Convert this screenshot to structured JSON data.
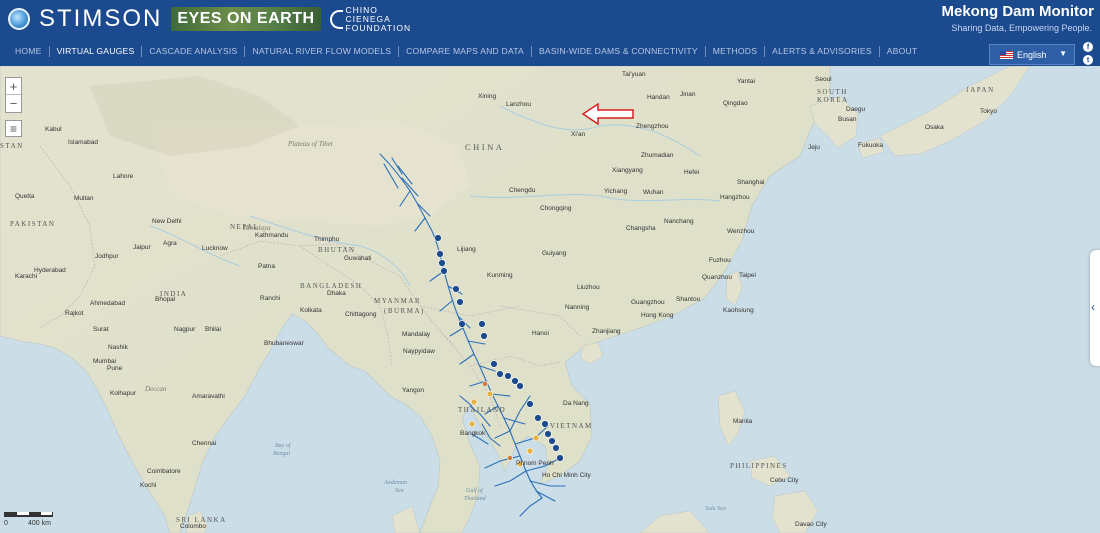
{
  "header": {
    "stimson": "STIMSON",
    "eyes_on_earth": "EYES ON EARTH",
    "chino_line1": "CHINO",
    "chino_line2": "CIENEGA",
    "chino_line3": "FOUNDATION",
    "title": "Mekong Dam Monitor",
    "subtitle": "Sharing Data, Empowering People."
  },
  "nav": {
    "items": [
      {
        "label": "HOME",
        "active": false
      },
      {
        "label": "VIRTUAL GAUGES",
        "active": true
      },
      {
        "label": "CASCADE ANALYSIS",
        "active": false
      },
      {
        "label": "NATURAL RIVER FLOW MODELS",
        "active": false
      },
      {
        "label": "COMPARE MAPS AND DATA",
        "active": false
      },
      {
        "label": "BASIN-WIDE DAMS & CONNECTIVITY",
        "active": false
      },
      {
        "label": "METHODS",
        "active": false
      },
      {
        "label": "ALERTS & ADVISORIES",
        "active": false
      },
      {
        "label": "ABOUT",
        "active": false
      }
    ]
  },
  "language": {
    "selected": "English",
    "caret": "▼"
  },
  "social": {
    "facebook": "f",
    "twitter": "t"
  },
  "map_controls": {
    "zoom_in": "+",
    "zoom_out": "−",
    "layers": "≡",
    "side_toggle": "‹"
  },
  "scale": {
    "start": "0",
    "end": "400 km"
  },
  "map_labels": {
    "countries": [
      "CHINA",
      "INDIA",
      "PAKISTAN",
      "BANGLADESH",
      "BHUTAN",
      "MYANMAR",
      "(BURMA)",
      "THAILAND",
      "VIETNAM",
      "PHILIPPINES",
      "SRI LANKA",
      "JAPAN",
      "SOUTH",
      "KOREA",
      "NEPAL",
      "STAN"
    ],
    "regions": [
      "Plateau of Tibet"
    ],
    "seas": [
      "Bay of",
      "Bengal",
      "Andaman",
      "Sea",
      "Gulf of",
      "Thailand",
      "Sulu Sea"
    ],
    "cities": [
      "Tai'yuan",
      "Xining",
      "Lanzhou",
      "Handan",
      "Jinan",
      "Yantai",
      "Qingdao",
      "Seoul",
      "Daegu",
      "Busan",
      "Osaka",
      "Tokyo",
      "Jeju",
      "Fukuoka",
      "Xi'an",
      "Zhengzhou",
      "Zhumadian",
      "Hefei",
      "Xiangyang",
      "Yichang",
      "Wuhan",
      "Shanghai",
      "Hangzhou",
      "Chengdu",
      "Chongqing",
      "Nanchang",
      "Changsha",
      "Wenzhou",
      "Lijiang",
      "Guiyang",
      "Fuzhou",
      "Kunming",
      "Liuzhou",
      "Quanzhou",
      "Taipei",
      "Kaohsiung",
      "Nanning",
      "Guangzhou",
      "Shantou",
      "Hong Kong",
      "Zhanjiang",
      "Hanoi",
      "Islamabad",
      "Kabul",
      "Lahore",
      "Multan",
      "Quetta",
      "Karachi",
      "New Delhi",
      "Jaipur",
      "Agra",
      "Lucknow",
      "Jodhpur",
      "Hyderabad",
      "Kathmandu",
      "Thimphu",
      "Guwahati",
      "Patna",
      "Ranchi",
      "Dhaka",
      "Kolkata",
      "Chittagong",
      "Ahmedabad",
      "Bhopal",
      "Rajkot",
      "Surat",
      "Nagpur",
      "Bhilai",
      "Nashik",
      "Mumbai",
      "Pune",
      "Bhubaneswar",
      "Mandalay",
      "Naypyidaw",
      "Yangon",
      "Kolhapur",
      "Amaravathi",
      "Chennai",
      "Coimbatore",
      "Kochi",
      "Colombo",
      "Bangkok",
      "Da Nang",
      "Phnom Penh",
      "Ho Chi Minh City",
      "Manila",
      "Cebu City",
      "Davao City",
      "Deccan",
      "Himalaya"
    ]
  }
}
